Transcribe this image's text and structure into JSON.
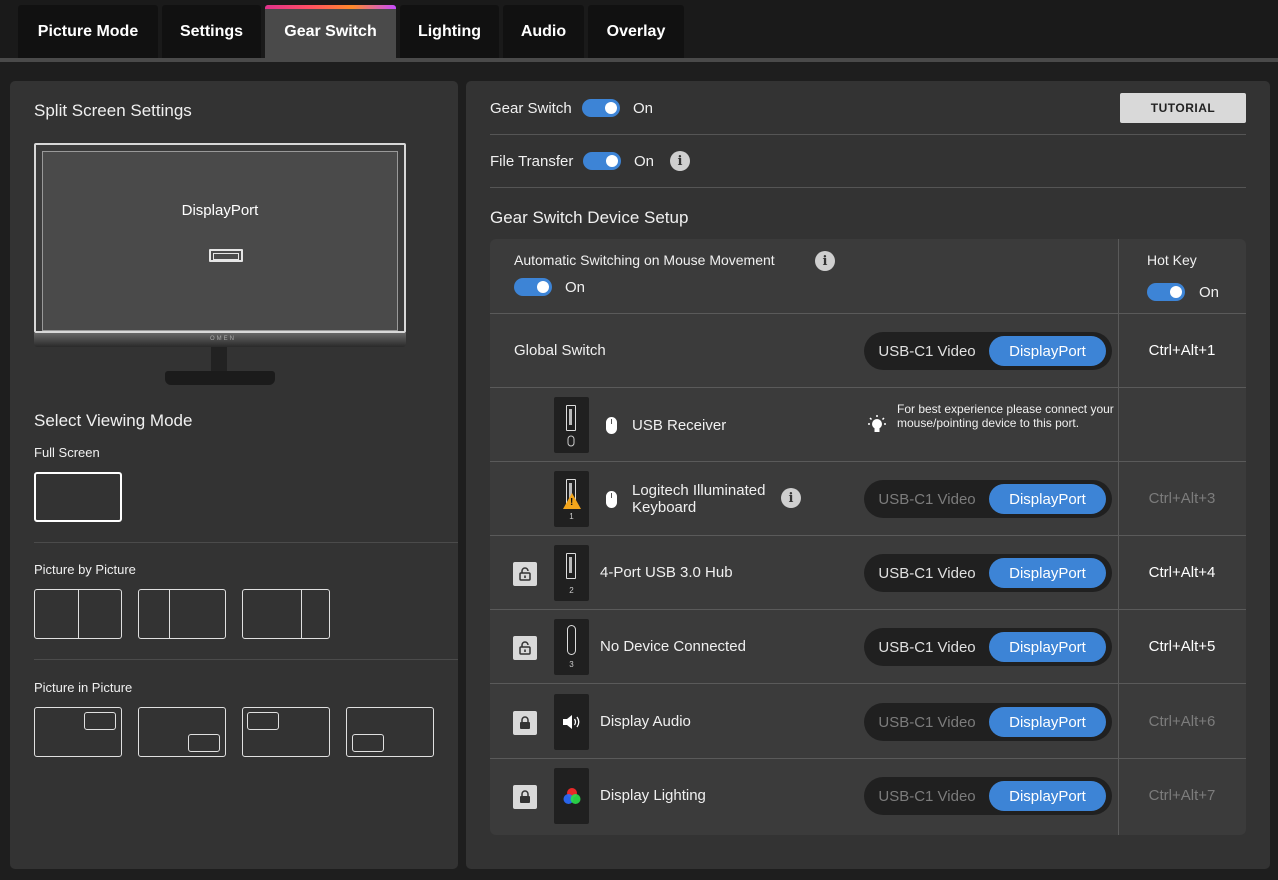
{
  "tabs": [
    {
      "label": "Picture Mode"
    },
    {
      "label": "Settings"
    },
    {
      "label": "Gear Switch"
    },
    {
      "label": "Lighting"
    },
    {
      "label": "Audio"
    },
    {
      "label": "Overlay"
    }
  ],
  "active_tab": "Gear Switch",
  "colors": {
    "accent": "#3d84d6",
    "warning": "#f2a51c"
  },
  "left": {
    "split_title": "Split Screen Settings",
    "monitor_label": "DisplayPort",
    "monitor_logo": "OMEN",
    "viewing_title": "Select Viewing Mode",
    "full_screen_label": "Full Screen",
    "pbp_label": "Picture by Picture",
    "pip_label": "Picture in Picture"
  },
  "right": {
    "gear_switch_label": "Gear Switch",
    "gear_switch_state": "On",
    "tutorial_label": "TUTORIAL",
    "file_transfer_label": "File Transfer",
    "file_transfer_state": "On",
    "setup_title": "Gear Switch Device Setup",
    "auto_switch_label": "Automatic Switching on Mouse Movement",
    "auto_switch_state": "On",
    "hotkey_header": "Hot Key",
    "hotkey_state": "On",
    "seg_left": "USB-C1 Video",
    "seg_right": "DisplayPort",
    "global_switch_label": "Global Switch",
    "global_hotkey": "Ctrl+Alt+1",
    "usb_receiver_label": "USB Receiver",
    "usb_receiver_tile": "1",
    "usb_receiver_note": "For best experience please connect your mouse/pointing device to this port.",
    "keyboard_label": "Logitech Illuminated Keyboard",
    "keyboard_tile": "1",
    "keyboard_hotkey": "Ctrl+Alt+3",
    "hub_label": "4-Port USB 3.0 Hub",
    "hub_tile": "2",
    "hub_hotkey": "Ctrl+Alt+4",
    "nodev_label": "No Device Connected",
    "nodev_tile": "3",
    "nodev_hotkey": "Ctrl+Alt+5",
    "audio_label": "Display Audio",
    "audio_hotkey": "Ctrl+Alt+6",
    "lighting_label": "Display Lighting",
    "lighting_hotkey": "Ctrl+Alt+7"
  }
}
